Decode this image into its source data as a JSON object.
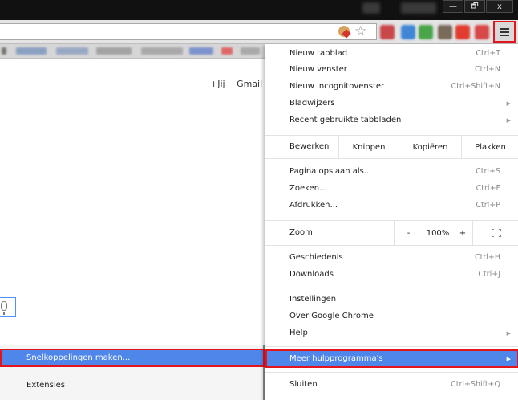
{
  "window": {
    "minimize_glyph": "—",
    "restore_glyph": "🗗",
    "close_glyph": "x"
  },
  "toolbar": {
    "star_icon": "☆",
    "menu_icon": "hamburger-menu-icon"
  },
  "page": {
    "links": [
      "+Jij",
      "Gmail"
    ]
  },
  "submenu": {
    "highlighted": "Snelkoppelingen maken...",
    "next": "Extensies"
  },
  "menu": {
    "group1": [
      {
        "label": "Nieuw tabblad",
        "shortcut": "Ctrl+T"
      },
      {
        "label": "Nieuw venster",
        "shortcut": "Ctrl+N"
      },
      {
        "label": "Nieuw incognitovenster",
        "shortcut": "Ctrl+Shift+N"
      },
      {
        "label": "Bladwijzers",
        "arrow": "▶"
      },
      {
        "label": "Recent gebruikte tabbladen",
        "arrow": "▶"
      }
    ],
    "edit": {
      "label": "Bewerken",
      "cut": "Knippen",
      "copy": "Kopiëren",
      "paste": "Plakken"
    },
    "group2": [
      {
        "label": "Pagina opslaan als...",
        "shortcut": "Ctrl+S"
      },
      {
        "label": "Zoeken...",
        "shortcut": "Ctrl+F"
      },
      {
        "label": "Afdrukken...",
        "shortcut": "Ctrl+P"
      }
    ],
    "zoom": {
      "label": "Zoom",
      "minus": "-",
      "value": "100%",
      "plus": "+"
    },
    "group3": [
      {
        "label": "Geschiedenis",
        "shortcut": "Ctrl+H"
      },
      {
        "label": "Downloads",
        "shortcut": "Ctrl+J"
      }
    ],
    "group4": [
      {
        "label": "Instellingen"
      },
      {
        "label": "Over Google Chrome"
      },
      {
        "label": "Help",
        "arrow": "▶"
      }
    ],
    "more_tools": {
      "label": "Meer hulpprogramma's",
      "arrow": "▶"
    },
    "quit": {
      "label": "Sluiten",
      "shortcut": "Ctrl+Shift+Q"
    }
  },
  "colors": {
    "highlight": "#4f86ea",
    "annotation": "#e3141b"
  }
}
